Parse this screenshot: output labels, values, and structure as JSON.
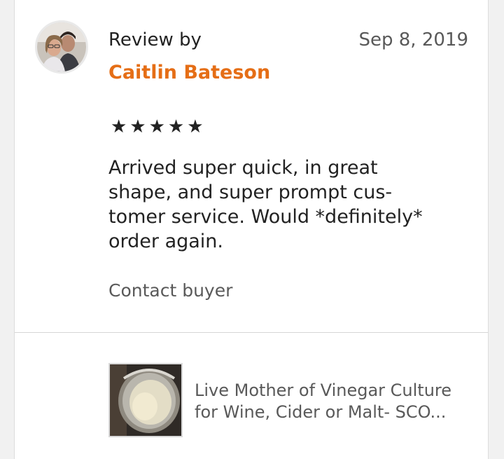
{
  "review": {
    "header_label": "Review by",
    "date": "Sep 8, 2019",
    "reviewer_name": "Caitlin Bateson",
    "rating": 5,
    "stars_display": "★★★★★",
    "text_lines": [
      "Arrived super quick, in great",
      "shape, and super prompt cus-",
      "tomer service. Would *definitely*",
      "order again."
    ],
    "contact_label": "Contact buyer"
  },
  "product": {
    "title_lines": [
      "Live Mother of Vinegar Culture",
      "for Wine, Cider or Malt- SCO..."
    ]
  },
  "colors": {
    "accent": "#e56e16",
    "text": "#222222",
    "muted": "#595959",
    "background": "#f1f1f1"
  }
}
